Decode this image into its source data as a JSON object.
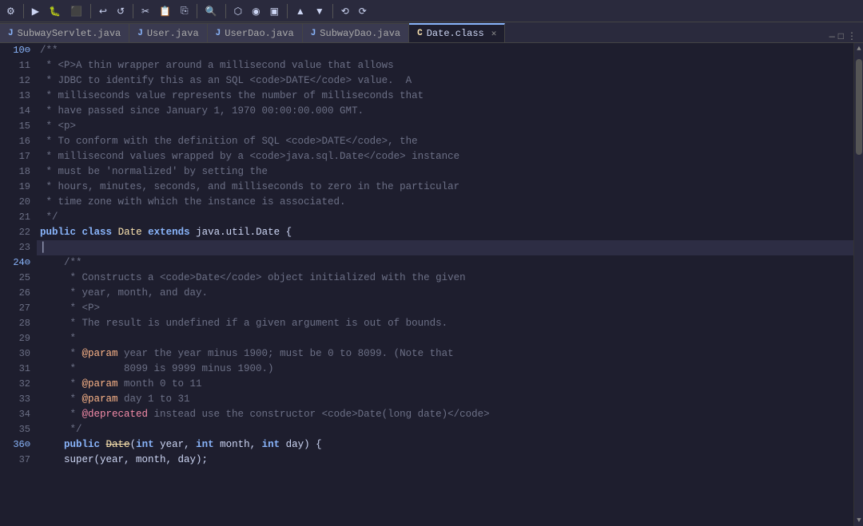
{
  "toolbar": {
    "buttons": [
      "⚙",
      "▶",
      "⏸",
      "⬛",
      "↩",
      "↺",
      "≡",
      "✂",
      "📋",
      "⎘",
      "⏏",
      "🔍",
      "⬡",
      "◉",
      "▣",
      "⊞",
      "⊟",
      "⊞",
      "⚡",
      "🔗",
      "▲",
      "▼",
      "⟲",
      "⟳"
    ]
  },
  "tabs": [
    {
      "id": "subway-servlet",
      "label": "SubwayServlet.java",
      "icon": "J",
      "active": false
    },
    {
      "id": "user",
      "label": "User.java",
      "icon": "J",
      "active": false
    },
    {
      "id": "user-dao",
      "label": "UserDao.java",
      "icon": "J",
      "active": false
    },
    {
      "id": "subway-dao",
      "label": "SubwayDao.java",
      "icon": "J",
      "active": false
    },
    {
      "id": "date-class",
      "label": "Date.class",
      "icon": "C",
      "active": true
    }
  ],
  "lines": [
    {
      "num": "10⊖",
      "fold": true,
      "content": "/**",
      "type": "comment"
    },
    {
      "num": "11",
      "fold": false,
      "content": " * <P>A thin wrapper around a millisecond value that allows",
      "type": "comment"
    },
    {
      "num": "12",
      "fold": false,
      "content": " * JDBC to identify this as an SQL <code>DATE</code> value.  A",
      "type": "comment"
    },
    {
      "num": "13",
      "fold": false,
      "content": " * milliseconds value represents the number of milliseconds that",
      "type": "comment"
    },
    {
      "num": "14",
      "fold": false,
      "content": " * have passed since January 1, 1970 00:00:00.000 GMT.",
      "type": "comment"
    },
    {
      "num": "15",
      "fold": false,
      "content": " * <p>",
      "type": "comment"
    },
    {
      "num": "16",
      "fold": false,
      "content": " * To conform with the definition of SQL <code>DATE</code>, the",
      "type": "comment"
    },
    {
      "num": "17",
      "fold": false,
      "content": " * millisecond values wrapped by a <code>java.sql.Date</code> instance",
      "type": "comment"
    },
    {
      "num": "18",
      "fold": false,
      "content": " * must be 'normalized' by setting the",
      "type": "comment"
    },
    {
      "num": "19",
      "fold": false,
      "content": " * hours, minutes, seconds, and milliseconds to zero in the particular",
      "type": "comment"
    },
    {
      "num": "20",
      "fold": false,
      "content": " * time zone with which the instance is associated.",
      "type": "comment"
    },
    {
      "num": "21",
      "fold": false,
      "content": " */",
      "type": "comment"
    },
    {
      "num": "22",
      "fold": false,
      "content": "public class Date extends java.util.Date {",
      "type": "code"
    },
    {
      "num": "23",
      "fold": false,
      "content": "",
      "type": "cursor"
    },
    {
      "num": "24⊖",
      "fold": true,
      "content": "    /**",
      "type": "comment"
    },
    {
      "num": "25",
      "fold": false,
      "content": "     * Constructs a <code>Date</code> object initialized with the given",
      "type": "comment"
    },
    {
      "num": "26",
      "fold": false,
      "content": "     * year, month, and day.",
      "type": "comment"
    },
    {
      "num": "27",
      "fold": false,
      "content": "     * <P>",
      "type": "comment"
    },
    {
      "num": "28",
      "fold": false,
      "content": "     * The result is undefined if a given argument is out of bounds.",
      "type": "comment"
    },
    {
      "num": "29",
      "fold": false,
      "content": "     *",
      "type": "comment"
    },
    {
      "num": "30",
      "fold": false,
      "content": "     * @param year the year minus 1900; must be 0 to 8099. (Note that",
      "type": "comment"
    },
    {
      "num": "31",
      "fold": false,
      "content": "     *        8099 is 9999 minus 1900.)",
      "type": "comment"
    },
    {
      "num": "32",
      "fold": false,
      "content": "     * @param month 0 to 11",
      "type": "comment"
    },
    {
      "num": "33",
      "fold": false,
      "content": "     * @param day 1 to 31",
      "type": "comment"
    },
    {
      "num": "34",
      "fold": false,
      "content": "     * @deprecated instead use the constructor <code>Date(long date)</code>",
      "type": "comment"
    },
    {
      "num": "35",
      "fold": false,
      "content": "     */",
      "type": "comment"
    },
    {
      "num": "36⊖",
      "fold": true,
      "content": "    public Date(int year, int month, int day) {",
      "type": "code"
    },
    {
      "num": "37",
      "fold": false,
      "content": "    super(year, month, day);",
      "type": "code"
    }
  ]
}
